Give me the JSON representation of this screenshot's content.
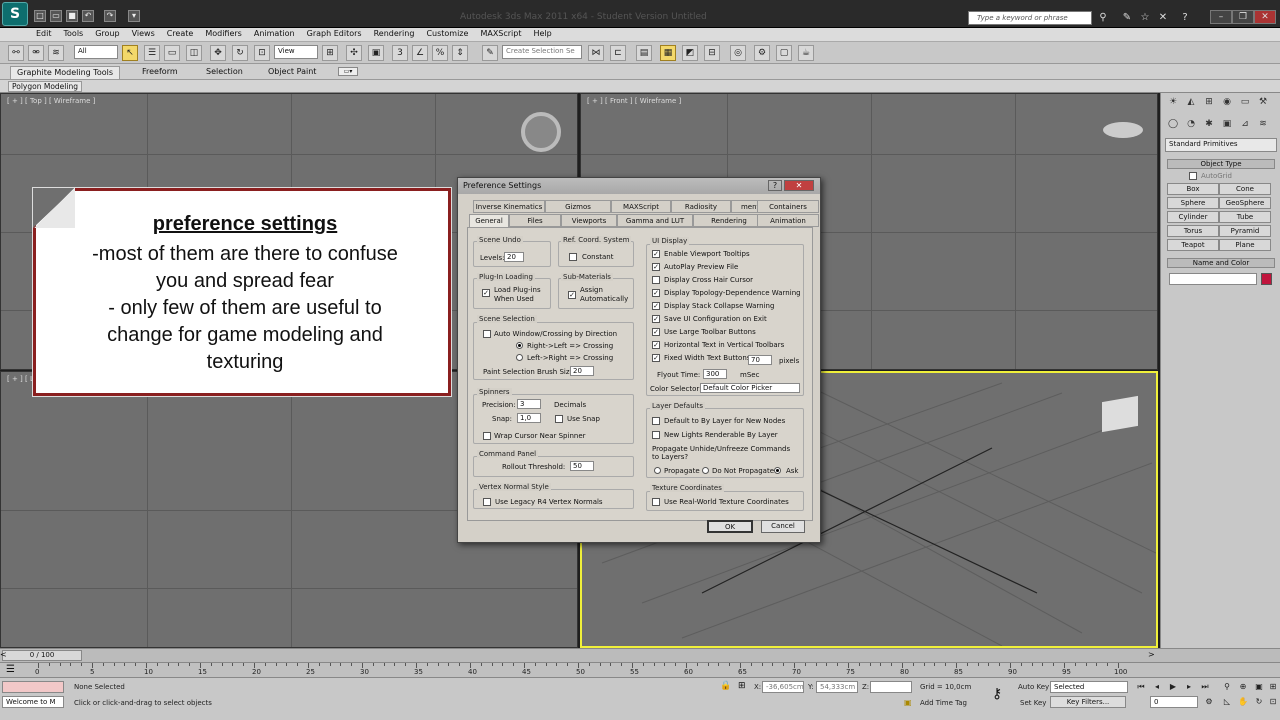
{
  "app": {
    "title": "Autodesk 3ds Max 2011 x64 - Student Version  Untitled",
    "logo": "S",
    "search_placeholder": "Type a keyword or phrase"
  },
  "menu": [
    "Edit",
    "Tools",
    "Group",
    "Views",
    "Create",
    "Modifiers",
    "Animation",
    "Graph Editors",
    "Rendering",
    "Customize",
    "MAXScript",
    "Help"
  ],
  "toolbar": {
    "filter_select": "All",
    "view_select": "View",
    "named_sel_placeholder": "Create Selection Se"
  },
  "ribbon": {
    "tabs": [
      "Graphite Modeling Tools",
      "Freeform",
      "Selection",
      "Object Paint"
    ],
    "sub": "Polygon Modeling"
  },
  "viewports": {
    "top": "[ + ] [ Top ] [ Wireframe ]",
    "front": "[ + ] [ Front ] [ Wireframe ]",
    "left": "[ + ] [ Le"
  },
  "command_panel": {
    "dropdown": "Standard Primitives",
    "object_type": "Object Type",
    "autogrid": "AutoGrid",
    "buttons": [
      "Box",
      "Cone",
      "Sphere",
      "GeoSphere",
      "Cylinder",
      "Tube",
      "Torus",
      "Pyramid",
      "Teapot",
      "Plane"
    ],
    "name_color": "Name and Color",
    "color": "#c0143c"
  },
  "timeline": {
    "frame": "0 / 100",
    "ticks": [
      "0",
      "5",
      "10",
      "15",
      "20",
      "25",
      "30",
      "35",
      "40",
      "45",
      "50",
      "55",
      "60",
      "65",
      "70",
      "75",
      "80",
      "85",
      "90",
      "95",
      "100"
    ]
  },
  "status": {
    "selected": "None Selected",
    "prompt": "Click or click-and-drag to select objects",
    "welcome": "Welcome to M",
    "x_label": "X:",
    "x": "-36,605cm",
    "y_label": "Y:",
    "y": "54,333cm",
    "z_label": "Z:",
    "z": "",
    "grid": "Grid = 10,0cm",
    "add_time_tag": "Add Time Tag",
    "auto_key": "Auto Key",
    "set_key": "Set Key",
    "key_mode": "Selected",
    "key_filters": "Key Filters...",
    "frame": "0"
  },
  "dialog": {
    "title": "Preference Settings",
    "tabs_row1": [
      "Inverse Kinematics",
      "Gizmos",
      "MAXScript",
      "Radiosity",
      "mental ray",
      "Containers"
    ],
    "tabs_row2": [
      "General",
      "Files",
      "Viewports",
      "Gamma and LUT",
      "Rendering",
      "Animation"
    ],
    "scene_undo": {
      "title": "Scene Undo",
      "levels_label": "Levels:",
      "levels": "20"
    },
    "ref_coord": {
      "title": "Ref. Coord. System",
      "constant": "Constant"
    },
    "plugin": {
      "title": "Plug-In Loading",
      "label1": "Load Plug-ins",
      "label2": "When Used"
    },
    "submat": {
      "title": "Sub-Materials",
      "label1": "Assign",
      "label2": "Automatically"
    },
    "scene_sel": {
      "title": "Scene Selection",
      "auto_window": "Auto Window/Crossing by Direction",
      "rl": "Right->Left => Crossing",
      "lr": "Left->Right => Crossing",
      "brush_label": "Paint Selection Brush Size",
      "brush": "20"
    },
    "spinners": {
      "title": "Spinners",
      "precision_label": "Precision:",
      "precision": "3",
      "decimals": "Decimals",
      "snap_label": "Snap:",
      "snap": "1,0",
      "use_snap": "Use Snap",
      "wrap": "Wrap Cursor Near Spinner"
    },
    "command_panel": {
      "title": "Command Panel",
      "rollout_label": "Rollout Threshold:",
      "rollout": "50"
    },
    "vertex_normal": {
      "title": "Vertex Normal Style",
      "legacy": "Use Legacy R4 Vertex Normals"
    },
    "ui_display": {
      "title": "UI Display",
      "items": [
        {
          "label": "Enable Viewport Tooltips",
          "checked": true
        },
        {
          "label": "AutoPlay Preview File",
          "checked": true
        },
        {
          "label": "Display Cross Hair Cursor",
          "checked": false
        },
        {
          "label": "Display Topology-Dependence Warning",
          "checked": true
        },
        {
          "label": "Display Stack Collapse Warning",
          "checked": true
        },
        {
          "label": "Save UI Configuration on Exit",
          "checked": true
        },
        {
          "label": "Use Large Toolbar Buttons",
          "checked": true
        },
        {
          "label": "Horizontal Text in Vertical Toolbars",
          "checked": true
        },
        {
          "label": "Fixed Width Text Buttons",
          "checked": true
        }
      ],
      "fixed_width": "70",
      "pixels": "pixels",
      "flyout_label": "Flyout Time:",
      "flyout": "300",
      "msec": "mSec",
      "color_selector_label": "Color Selector:",
      "color_selector": "Default Color Picker"
    },
    "layer_defaults": {
      "title": "Layer Defaults",
      "by_layer": "Default to By Layer for New Nodes",
      "new_lights": "New Lights Renderable By Layer",
      "propagate": "Propagate Unhide/Unfreeze Commands to Layers?",
      "opt_propagate": "Propagate",
      "opt_no": "Do Not Propagate",
      "opt_ask": "Ask"
    },
    "tex_coords": {
      "title": "Texture Coordinates",
      "real_world": "Use Real-World Texture Coordinates"
    },
    "ok": "OK",
    "cancel": "Cancel"
  },
  "note": {
    "title": "preference settings",
    "lines": [
      "-most of them are there to confuse",
      "you and spread fear",
      "- only few of them are useful to",
      "change for game modeling and",
      "texturing"
    ]
  }
}
